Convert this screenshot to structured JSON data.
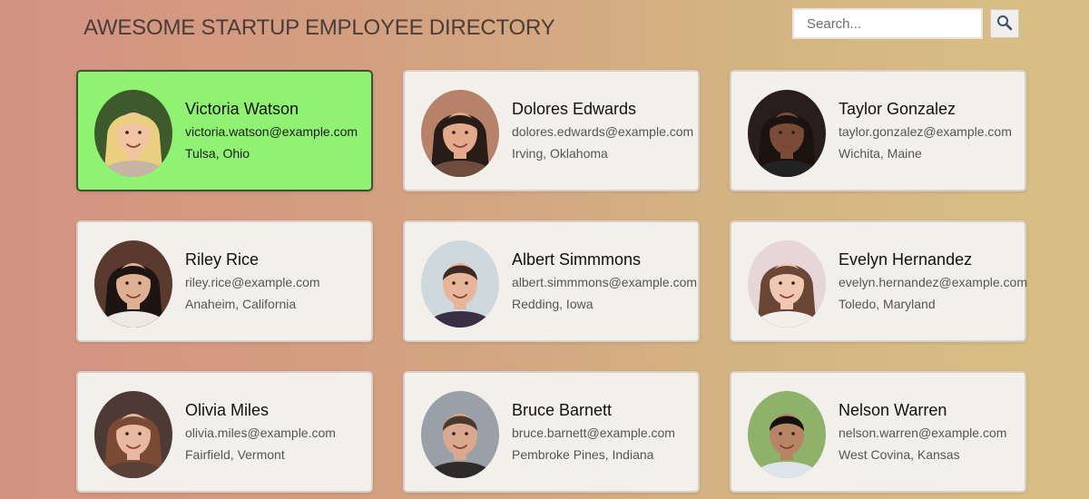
{
  "header": {
    "title": "AWESOME STARTUP EMPLOYEE DIRECTORY"
  },
  "search": {
    "placeholder": "Search...",
    "value": "",
    "button_icon": "search-icon"
  },
  "colors": {
    "selected_card": "#8ff272",
    "card": "#f3efea"
  },
  "employees": [
    {
      "name": "Victoria Watson",
      "email": "victoria.watson@example.com",
      "location": "Tulsa, Ohio",
      "selected": true,
      "avatar": {
        "bg": "#3e5a2c",
        "skin": "#f2c4a2",
        "hair": "#ead07e",
        "shirt": "#c8b4a4",
        "long": true
      }
    },
    {
      "name": "Dolores Edwards",
      "email": "dolores.edwards@example.com",
      "location": "Irving, Oklahoma",
      "selected": false,
      "avatar": {
        "bg": "#b8826a",
        "skin": "#e2a98a",
        "hair": "#281c18",
        "shirt": "#6f4c3c",
        "long": true
      }
    },
    {
      "name": "Taylor Gonzalez",
      "email": "taylor.gonzalez@example.com",
      "location": "Wichita, Maine",
      "selected": false,
      "avatar": {
        "bg": "#2a1e1c",
        "skin": "#7a4c38",
        "hair": "#1c1210",
        "shirt": "#222222",
        "long": true
      }
    },
    {
      "name": "Riley Rice",
      "email": "riley.rice@example.com",
      "location": "Anaheim, California",
      "selected": false,
      "avatar": {
        "bg": "#5a3a2e",
        "skin": "#ddb094",
        "hair": "#1e1412",
        "shirt": "#ece8e2",
        "long": true
      }
    },
    {
      "name": "Albert Simmmons",
      "email": "albert.simmmons@example.com",
      "location": "Redding, Iowa",
      "selected": false,
      "avatar": {
        "bg": "#cfd8dc",
        "skin": "#e6b59a",
        "hair": "#3c2a22",
        "shirt": "#3a2e44",
        "long": false
      }
    },
    {
      "name": "Evelyn Hernandez",
      "email": "evelyn.hernandez@example.com",
      "location": "Toledo, Maryland",
      "selected": false,
      "avatar": {
        "bg": "#e6d6d8",
        "skin": "#f0c8b2",
        "hair": "#6a4636",
        "shirt": "#f2eeee",
        "long": true
      }
    },
    {
      "name": "Olivia Miles",
      "email": "olivia.miles@example.com",
      "location": "Fairfield, Vermont",
      "selected": false,
      "avatar": {
        "bg": "#4e3a34",
        "skin": "#e9b8a0",
        "hair": "#7a4a34",
        "shirt": "#5a4038",
        "long": true
      }
    },
    {
      "name": "Bruce Barnett",
      "email": "bruce.barnett@example.com",
      "location": "Pembroke Pines, Indiana",
      "selected": false,
      "avatar": {
        "bg": "#9aa0a8",
        "skin": "#d9a88e",
        "hair": "#4a382e",
        "shirt": "#2e2a2a",
        "long": false
      }
    },
    {
      "name": "Nelson Warren",
      "email": "nelson.warren@example.com",
      "location": "West Covina, Kansas",
      "selected": false,
      "avatar": {
        "bg": "#8fb26a",
        "skin": "#b78466",
        "hair": "#141010",
        "shirt": "#dde4ec",
        "long": false
      }
    }
  ]
}
